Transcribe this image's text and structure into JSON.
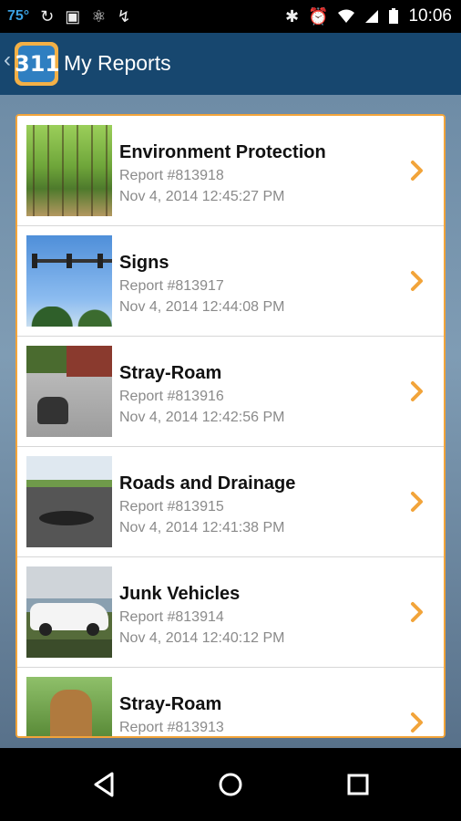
{
  "status_bar": {
    "temperature": "75°",
    "time": "10:06",
    "left_icons": [
      "sync-icon",
      "flipboard-icon",
      "android-icon",
      "flash-icon"
    ],
    "right_icons": [
      "bluetooth-icon",
      "alarm-icon",
      "wifi-icon",
      "signal-icon",
      "battery-icon"
    ]
  },
  "header": {
    "logo_text": "311",
    "title": "My Reports",
    "colors": {
      "bar": "#17476f",
      "logo_orange": "#f3b046",
      "logo_blue": "#2f7fc1"
    }
  },
  "reports": [
    {
      "title": "Environment Protection",
      "report": "Report #813918",
      "date": "Nov 4, 2014 12:45:27 PM",
      "thumbnail": "forest"
    },
    {
      "title": "Signs",
      "report": "Report #813917",
      "date": "Nov 4, 2014 12:44:08 PM",
      "thumbnail": "traffic-signals"
    },
    {
      "title": "Stray-Roam",
      "report": "Report #813916",
      "date": "Nov 4, 2014 12:42:56 PM",
      "thumbnail": "dog-on-gravel"
    },
    {
      "title": "Roads and Drainage",
      "report": "Report #813915",
      "date": "Nov 4, 2014 12:41:38 PM",
      "thumbnail": "pothole-road"
    },
    {
      "title": "Junk Vehicles",
      "report": "Report #813914",
      "date": "Nov 4, 2014 12:40:12 PM",
      "thumbnail": "white-car"
    },
    {
      "title": "Stray-Roam",
      "report": "Report #813913",
      "date": "",
      "thumbnail": "dog-portrait"
    }
  ],
  "accent_color": "#f2a43a",
  "nav_bar": {
    "buttons": [
      "back-icon",
      "home-icon",
      "recents-icon"
    ]
  }
}
